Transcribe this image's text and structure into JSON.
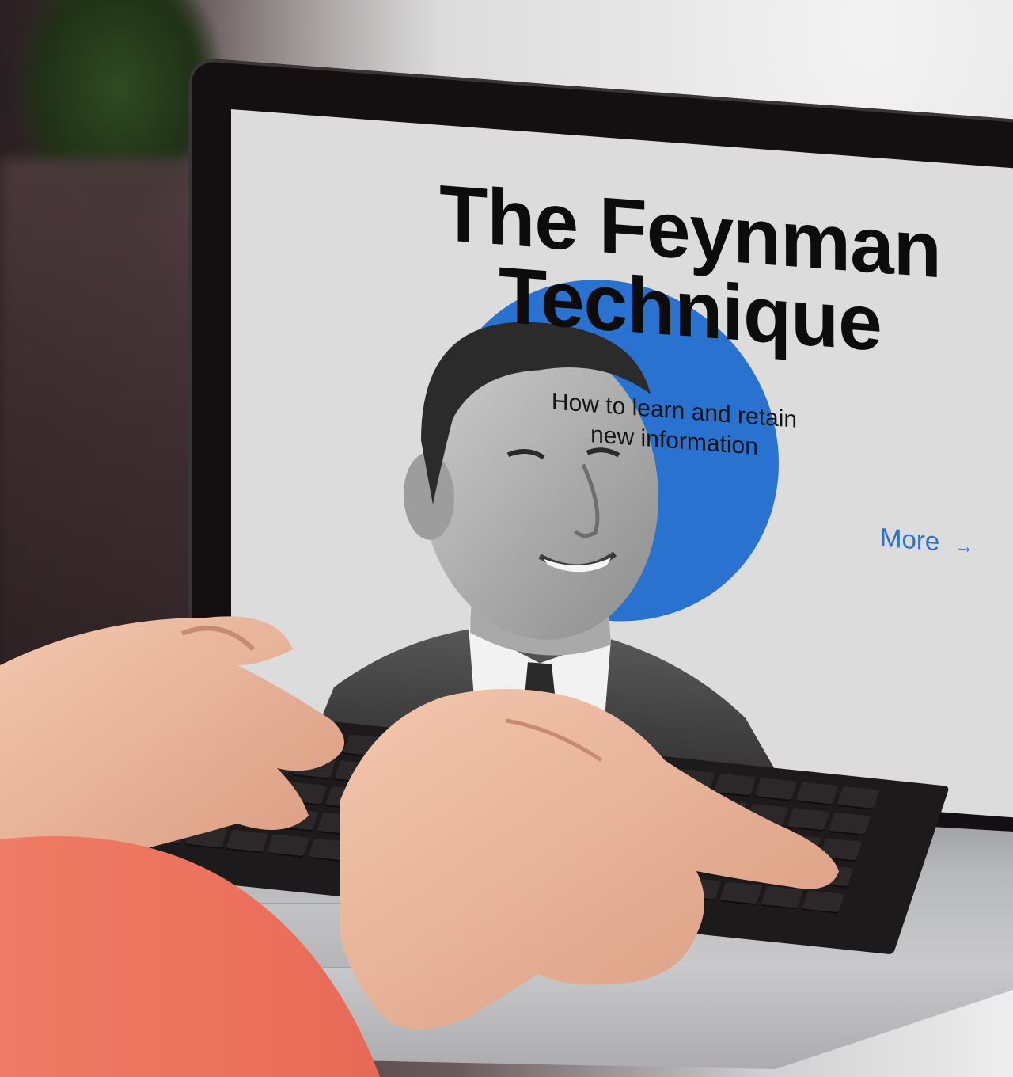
{
  "screen_page": {
    "title_line1": "The Feynman",
    "title_line2": "Technique",
    "subtitle_line1": "How to learn and retain",
    "subtitle_line2": "new information",
    "more_link": {
      "label": "More",
      "arrow": "→"
    }
  },
  "colors": {
    "accent": "#2a72d0",
    "screen_background": "#dcdcdc",
    "title_text": "#0c0c0c"
  },
  "icons": {
    "more_arrow": "arrow-right-icon"
  }
}
